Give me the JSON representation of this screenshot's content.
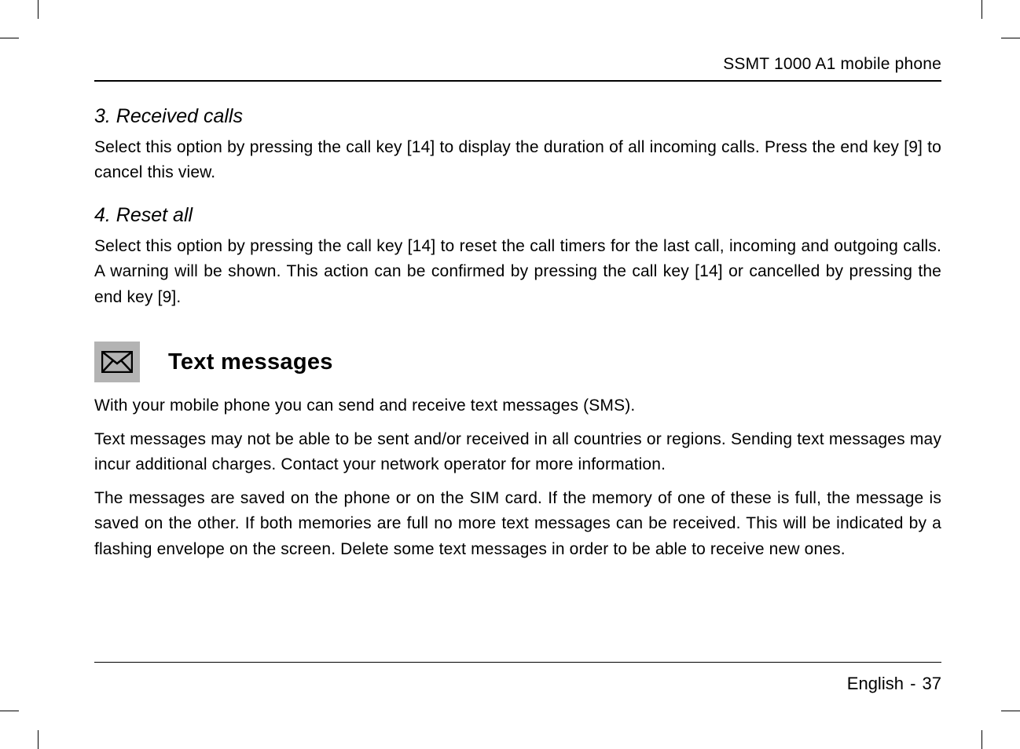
{
  "header": {
    "running_title": "SSMT 1000 A1 mobile phone"
  },
  "sections": {
    "received_calls": {
      "heading": "3. Received calls",
      "body": "Select this option by pressing the call key [14] to display the duration of all incoming calls. Press the end key [9] to cancel this view."
    },
    "reset_all": {
      "heading": "4. Reset all",
      "body": "Select this option by pressing the call key [14] to reset the call timers for the last call, incoming and outgoing calls. A warning will be shown. This action can be confirmed by pressing the call key [14] or cancelled by pressing the end key [9]."
    },
    "text_messages": {
      "icon": "envelope-icon",
      "heading": "Text messages",
      "para1": "With your mobile phone you can send and receive text messages (SMS).",
      "para2": "Text messages may not be able to be sent and/or received in all countries or regions. Sending text messages may incur additional charges. Contact your network operator for more information.",
      "para3": "The messages are saved on the phone or on the SIM card. If the memory of one of these is full, the message is saved on the other. If both memories are full no more text messages can be received. This will be indicated by a flashing envelope on the screen. Delete some text messages in order to be able to receive new ones."
    }
  },
  "footer": {
    "language": "English",
    "separator": "-",
    "page_number": "37"
  }
}
